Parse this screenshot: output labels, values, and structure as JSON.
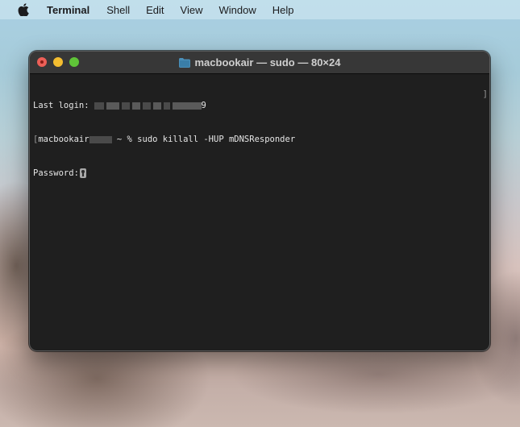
{
  "menubar": {
    "apple_icon": "apple-logo",
    "app_name": "Terminal",
    "items": [
      "Shell",
      "Edit",
      "View",
      "Window",
      "Help"
    ]
  },
  "window": {
    "title": "macbookair — sudo — 80×24",
    "title_icon": "folder-icon",
    "traffic_lights": {
      "close_color": "#ec5f57",
      "minimize_color": "#f3bd30",
      "maximize_color": "#5fc438"
    }
  },
  "terminal": {
    "background": "#1f1f1f",
    "lines": [
      {
        "prefix": "Last login:",
        "redacted": true,
        "suffix": "9"
      },
      {
        "prompt_host": "macbookair",
        "redacted": true,
        "prompt": "~ %",
        "command": "sudo killall -HUP mDNSResponder"
      },
      {
        "prefix": "Password:",
        "cursor_icon": "key-icon"
      }
    ]
  }
}
